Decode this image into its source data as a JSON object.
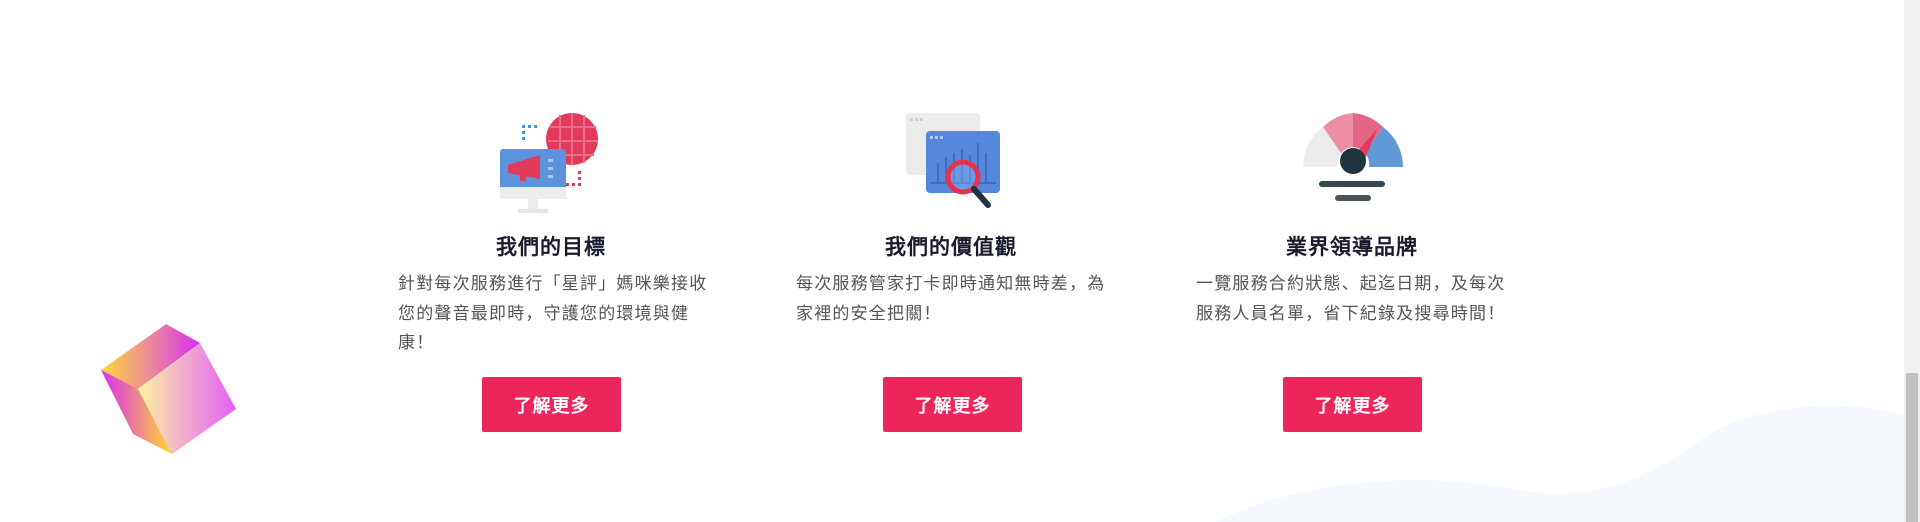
{
  "features": [
    {
      "icon": "megaphone-monitor-globe-icon",
      "title": "我們的目標",
      "description": "針對每次服務進行「星評」媽咪樂接收您的聲音最即時，守護您的環境與健康！",
      "button_label": "了解更多"
    },
    {
      "icon": "chart-magnifier-icon",
      "title": "我們的價值觀",
      "description": "每次服務管家打卡即時通知無時差，為家裡的安全把關！",
      "button_label": "了解更多"
    },
    {
      "icon": "speedometer-gauge-icon",
      "title": "業界領導品牌",
      "description": "一覽服務合約狀態、起迄日期，及每次服務人員名單，省下紀錄及搜尋時間！",
      "button_label": "了解更多"
    }
  ],
  "colors": {
    "accent": "#ec255a",
    "title": "#1b1b2f",
    "text": "#555555",
    "wave": "#f5f9fe"
  }
}
